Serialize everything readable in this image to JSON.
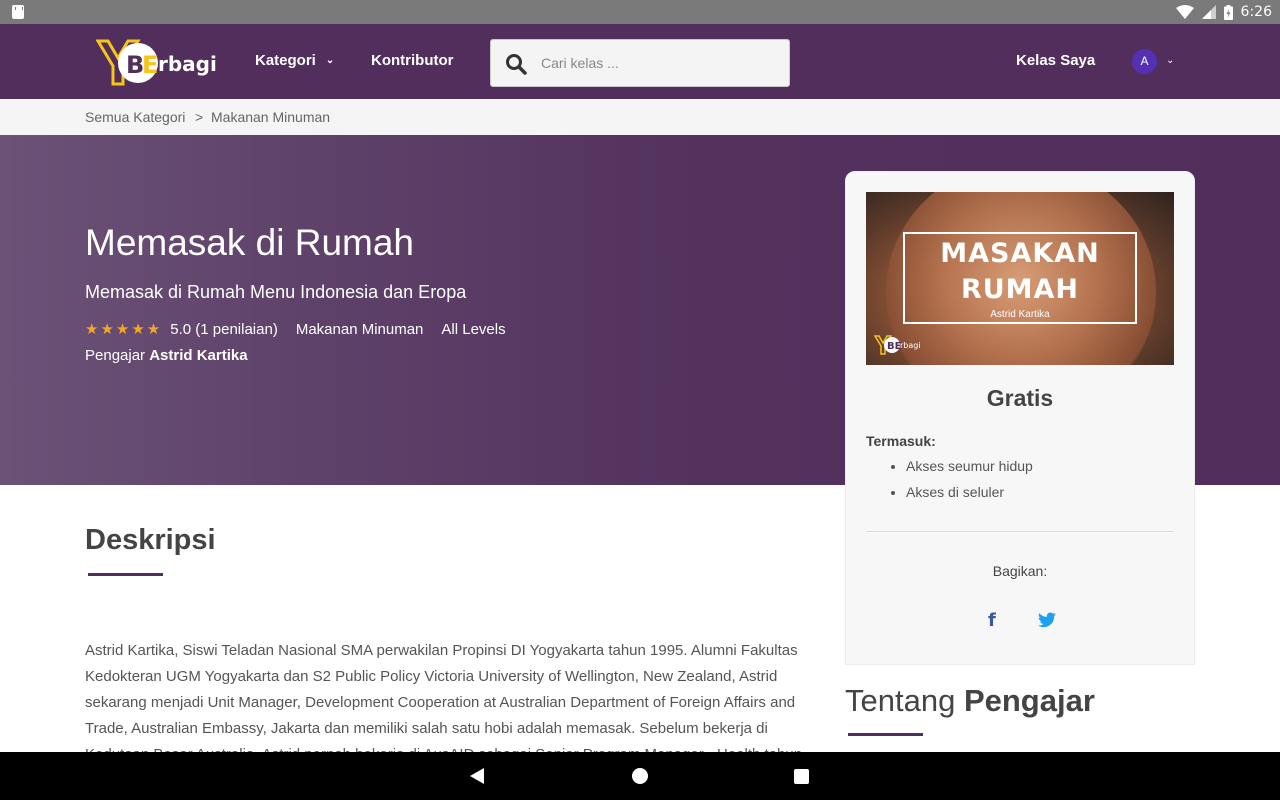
{
  "status_bar": {
    "time": "6:26"
  },
  "header": {
    "logo_text": "YBErbagi",
    "nav_kategori": "Kategori",
    "nav_kontributor": "Kontributor",
    "search_placeholder": "Cari kelas ...",
    "nav_kelas_saya": "Kelas Saya",
    "avatar_initial": "A",
    "colors": {
      "header_bg": "#522e5c",
      "accent": "#f5c518",
      "avatar": "#5530b5"
    }
  },
  "breadcrumb": {
    "items": [
      "Semua Kategori",
      "Makanan Minuman"
    ],
    "separator": ">"
  },
  "hero": {
    "title": "Memasak di Rumah",
    "subtitle": "Memasak di Rumah Menu Indonesia dan Eropa",
    "stars": "★★★★★",
    "rating": "5.0 (1 penilaian)",
    "category": "Makanan Minuman",
    "level": "All Levels",
    "teacher_label": "Pengajar",
    "teacher_name": "Astrid Kartika"
  },
  "card": {
    "thumbnail": {
      "line1": "MASAKAN",
      "line2": "RUMAH",
      "author": "Astrid Kartika"
    },
    "price": "Gratis",
    "includes_title": "Termasuk:",
    "includes": [
      "Akses seumur hidup",
      "Akses di seluler"
    ],
    "share_label": "Bagikan:",
    "share_icons": [
      "facebook-icon",
      "twitter-icon"
    ]
  },
  "description": {
    "title": "Deskripsi",
    "text": "Astrid Kartika, Siswi Teladan Nasional SMA perwakilan Propinsi DI Yogyakarta tahun 1995. Alumni Fakultas Kedokteran UGM Yogyakarta dan S2 Public Policy Victoria University of Wellington, New Zealand, Astrid sekarang menjadi Unit Manager, Development Cooperation at Australian Department of Foreign Affairs and Trade, Australian Embassy, Jakarta dan memiliki salah satu hobi adalah memasak. Sebelum bekerja di Kedutaan Besar Australia, Astrid pernah bekerja di AusAID sebagai Senior Program Manager - Health tahun"
  },
  "about": {
    "light": "Tentang",
    "bold": "Pengajar"
  }
}
